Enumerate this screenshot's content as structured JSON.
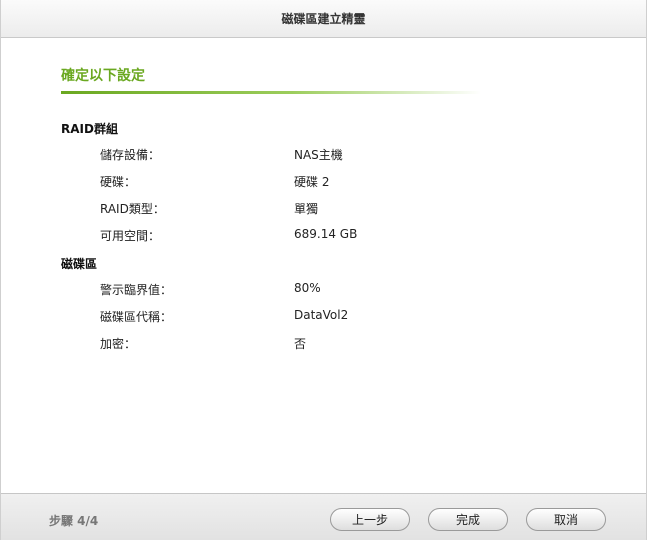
{
  "window": {
    "title": "磁碟區建立精靈"
  },
  "section": {
    "heading": "確定以下設定"
  },
  "raid_group": {
    "title": "RAID群組",
    "rows": [
      {
        "label": "儲存設備：",
        "value": "NAS主機"
      },
      {
        "label": "硬碟：",
        "value": "硬碟 2"
      },
      {
        "label": "RAID類型：",
        "value": "單獨"
      },
      {
        "label": "可用空間：",
        "value": "689.14 GB"
      }
    ]
  },
  "volume": {
    "title": "磁碟區",
    "rows": [
      {
        "label": "警示臨界值：",
        "value": "80%"
      },
      {
        "label": "磁碟區代稱：",
        "value": "DataVol2"
      },
      {
        "label": "加密：",
        "value": "否"
      }
    ]
  },
  "footer": {
    "step": "步驟 4/4",
    "back_label": "上一步",
    "finish_label": "完成",
    "cancel_label": "取消"
  }
}
